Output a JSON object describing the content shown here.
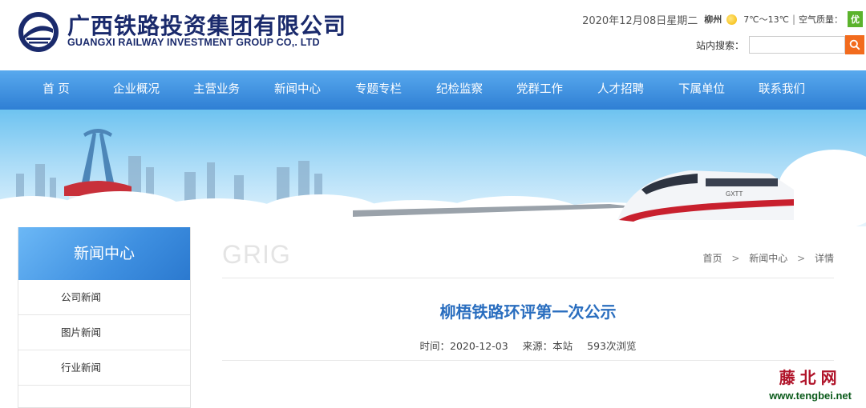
{
  "header": {
    "company_cn": "广西铁路投资集团有限公司",
    "company_en": "GUANGXI RAILWAY INVESTMENT GROUP CO,. LTD",
    "date": "2020年12月08日星期二",
    "city": "柳州",
    "temperature": "7℃～13℃",
    "separator": "|",
    "air_quality_label": "空气质量：",
    "air_quality_value": "优",
    "search_label": "站内搜索：",
    "search_value": "",
    "icons": {
      "logo": "railway-logo-icon",
      "weather": "sun-icon",
      "search": "search-icon"
    },
    "colors": {
      "brand": "#1a2a6c",
      "search_button": "#f26b1d",
      "air_good": "#5bb32c"
    }
  },
  "nav": {
    "items": [
      "首 页",
      "企业概况",
      "主营业务",
      "新闻中心",
      "专题专栏",
      "纪检监察",
      "党群工作",
      "人才招聘",
      "下属单位",
      "联系我们"
    ],
    "colors": {
      "background_top": "#58a9ee",
      "background_bottom": "#2f7fd4"
    }
  },
  "banner": {
    "train_label": "GXTT"
  },
  "sidebar": {
    "title": "新闻中心",
    "items": [
      "公司新闻",
      "图片新闻",
      "行业新闻"
    ]
  },
  "article": {
    "watermark": "GRIG",
    "breadcrumb": [
      "首页",
      "新闻中心",
      "详情"
    ],
    "breadcrumb_sep": ">",
    "title": "柳梧铁路环评第一次公示",
    "time": "时间：2020-12-03",
    "source": "来源：本站",
    "views": "593次浏览",
    "title_color": "#2a6ebf"
  },
  "watermark": {
    "cn": "藤北网",
    "en": "www.tengbei.net"
  }
}
